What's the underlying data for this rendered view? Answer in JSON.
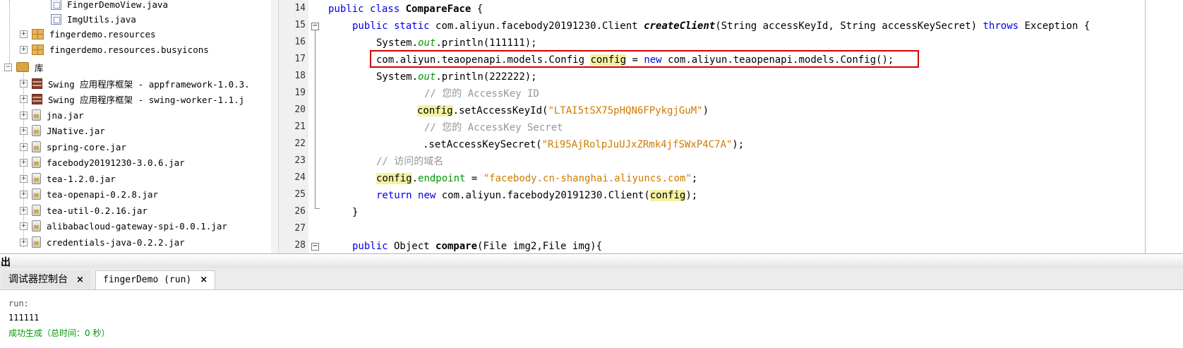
{
  "tree": {
    "items": [
      {
        "label": "FingerDemoView.java",
        "icon": "java-form-icon"
      },
      {
        "label": "ImgUtils.java",
        "icon": "java-file-icon"
      },
      {
        "label": "fingerdemo.resources",
        "icon": "package-icon"
      },
      {
        "label": "fingerdemo.resources.busyicons",
        "icon": "package-icon"
      },
      {
        "label": "库",
        "icon": "library-folder-icon"
      },
      {
        "label": "Swing 应用程序框架 - appframework-1.0.3.",
        "icon": "library-books-icon"
      },
      {
        "label": "Swing 应用程序框架 - swing-worker-1.1.j",
        "icon": "library-books-icon"
      },
      {
        "label": "jna.jar",
        "icon": "jar-icon"
      },
      {
        "label": "JNative.jar",
        "icon": "jar-icon"
      },
      {
        "label": "spring-core.jar",
        "icon": "jar-icon"
      },
      {
        "label": "facebody20191230-3.0.6.jar",
        "icon": "jar-icon"
      },
      {
        "label": "tea-1.2.0.jar",
        "icon": "jar-icon"
      },
      {
        "label": "tea-openapi-0.2.8.jar",
        "icon": "jar-icon"
      },
      {
        "label": "tea-util-0.2.16.jar",
        "icon": "jar-icon"
      },
      {
        "label": "alibabacloud-gateway-spi-0.0.1.jar",
        "icon": "jar-icon"
      },
      {
        "label": "credentials-java-0.2.2.jar",
        "icon": "jar-icon"
      }
    ]
  },
  "editor": {
    "line_numbers": [
      "14",
      "15",
      "16",
      "17",
      "18",
      "19",
      "20",
      "21",
      "22",
      "23",
      "24",
      "25",
      "26",
      "27",
      "28"
    ],
    "tokens": {
      "l14_a": "public class ",
      "l14_b": "CompareFace",
      "l14_c": " {",
      "l15_a": "public static ",
      "l15_b": "com.aliyun.facebody20191230.Client ",
      "l15_c": "createClient",
      "l15_d": "(String accessKeyId, String accessKeySecret) ",
      "l15_e": "throws",
      "l15_f": " Exception {",
      "l16_a": "System.",
      "l16_b": "out",
      "l16_c": ".println(111111);",
      "l17_a": "com.aliyun.teaopenapi.models.Config ",
      "l17_b": "config",
      "l17_c": " = ",
      "l17_d": "new",
      "l17_e": " com.aliyun.teaopenapi.models.Config();",
      "l18_a": "System.",
      "l18_b": "out",
      "l18_c": ".println(222222);",
      "l19": "// 您的 AccessKey ID",
      "l20_a": "config",
      "l20_b": ".setAccessKeyId(",
      "l20_c": "\"LTAI5tSX75pHQN6FPykgjGuM\"",
      "l20_d": ")",
      "l21": "// 您的 AccessKey Secret",
      "l22_a": ".setAccessKeySecret(",
      "l22_b": "\"Ri95AjRolpJuUJxZRmk4jfSWxP4C7A\"",
      "l22_c": ");",
      "l23": "// 访问的域名",
      "l24_a": "config",
      "l24_b": ".",
      "l24_c": "endpoint",
      "l24_d": " = ",
      "l24_e": "\"facebody.cn-shanghai.aliyuncs.com\"",
      "l24_f": ";",
      "l25_a": "return",
      "l25_b": " ",
      "l25_c": "new",
      "l25_d": " com.aliyun.facebody20191230.Client(",
      "l25_e": "config",
      "l25_f": ");",
      "l26": "}",
      "l28_a": "public",
      "l28_b": " Object ",
      "l28_c": "compare",
      "l28_d": "(File img2,File img){"
    }
  },
  "output": {
    "title": "出",
    "tabs": [
      {
        "label": "调试器控制台",
        "close": "×"
      },
      {
        "label": "fingerDemo (run)",
        "close": "×"
      }
    ],
    "lines": [
      "run:",
      "111111",
      "成功生成（总时间：0 秒）"
    ]
  },
  "colors": {
    "keyword": "#0000e6",
    "string": "#ce7b00",
    "comment": "#969696",
    "field": "#009900",
    "highlight": "#f4f1a2",
    "annotation_box": "#d40000",
    "success": "#009900"
  }
}
